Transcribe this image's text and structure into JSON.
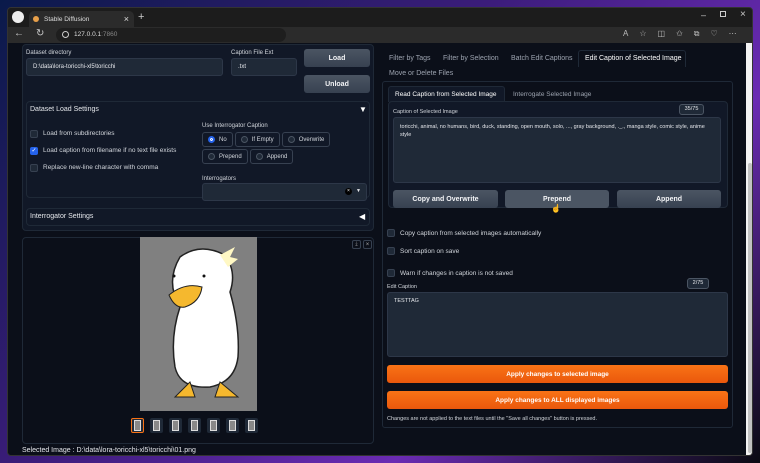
{
  "browser": {
    "tab_title": "Stable Diffusion",
    "url_host": "127.0.0.1",
    "url_port": ":7860"
  },
  "dataset": {
    "dir_label": "Dataset directory",
    "dir_value": "D:\\data\\lora-toricchi-xl5\\toricchi",
    "ext_label": "Caption File Ext",
    "ext_value": ".txt",
    "load": "Load",
    "unload": "Unload"
  },
  "load_settings": {
    "title": "Dataset Load Settings",
    "checkboxes": [
      {
        "label": "Load from subdirectories",
        "checked": false
      },
      {
        "label": "Load caption from filename if no text file exists",
        "checked": true
      },
      {
        "label": "Replace new-line character with comma",
        "checked": false
      }
    ],
    "interrogator_caption_label": "Use Interrogator Caption",
    "radios": [
      {
        "label": "No",
        "checked": true
      },
      {
        "label": "If Empty",
        "checked": false
      },
      {
        "label": "Overwrite",
        "checked": false
      },
      {
        "label": "Prepend",
        "checked": false
      },
      {
        "label": "Append",
        "checked": false
      }
    ],
    "interrogators_label": "Interrogators"
  },
  "interrogator_settings": {
    "title": "Interrogator Settings"
  },
  "gallery": {
    "selected_text": "Selected Image : D:\\data\\lora-toricchi-xl5\\toricchi\\01.png",
    "thumb_count": 7,
    "selected_index": 0
  },
  "tabs": [
    "Filter by Tags",
    "Filter by Selection",
    "Batch Edit Captions",
    "Edit Caption of Selected Image",
    "Move or Delete Files"
  ],
  "subtabs": [
    "Read Caption from Selected Image",
    "Interrogate Selected Image"
  ],
  "caption": {
    "label": "Caption of Selected Image",
    "counter": "35/75",
    "text": "toricchi, animal, no humans, bird, duck, standing, open mouth, solo, ..., gray background, ._., manga style, comic style, anime style",
    "copy": "Copy and Overwrite",
    "prepend": "Prepend",
    "append": "Append"
  },
  "options": [
    {
      "label": "Copy caption from selected images automatically",
      "checked": false
    },
    {
      "label": "Sort caption on save",
      "checked": false
    },
    {
      "label": "Warn if changes in caption is not saved",
      "checked": false
    }
  ],
  "edit": {
    "label": "Edit Caption",
    "counter": "2/75",
    "text": "TESTTAG",
    "apply_selected": "Apply changes to selected image",
    "apply_all": "Apply changes to ALL displayed images",
    "note": "Changes are not applied to the text files until the \"Save all changes\" button is pressed."
  }
}
